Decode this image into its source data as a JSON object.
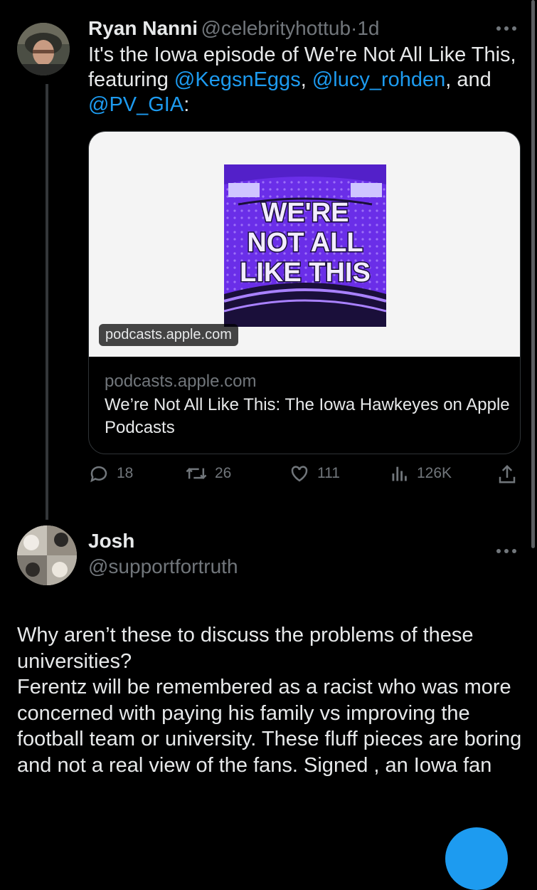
{
  "tweet": {
    "author_name": "Ryan Nanni",
    "author_handle": "@celebrityhottub",
    "separator": "·",
    "time": "1d",
    "text_before": "It's the Iowa episode of We're Not All Like This, featuring ",
    "mention1": "@KegsnEggs",
    "comma1": ", ",
    "mention2": "@lucy_rohden",
    "and": ", and",
    "mention3": "@PV_GIA",
    "text_after": ":",
    "card": {
      "artwork_lines": [
        "WE'RE",
        "NOT ALL",
        "LIKE THIS"
      ],
      "image_domain": "podcasts.apple.com",
      "domain": "podcasts.apple.com",
      "title": "We’re Not All Like This: The Iowa Hawkeyes on Apple Podcasts"
    },
    "stats": {
      "replies": "18",
      "reposts": "26",
      "likes": "111",
      "views": "126K"
    },
    "colors": {
      "accent": "#1d9bf0",
      "muted": "#71767b",
      "art_purple": "#6a2ee8"
    },
    "icons": [
      "reply-icon",
      "repost-icon",
      "like-icon",
      "views-icon",
      "share-icon",
      "more-icon"
    ]
  },
  "reply": {
    "author_name": "Josh",
    "author_handle": "@supportfortruth",
    "text": "Why aren’t these to discuss the problems of these universities?\nFerentz will be remembered as a racist who was more concerned with paying his family vs improving the football team or university. These fluff pieces are boring and not a real view of the fans. Signed , an Iowa fan"
  }
}
